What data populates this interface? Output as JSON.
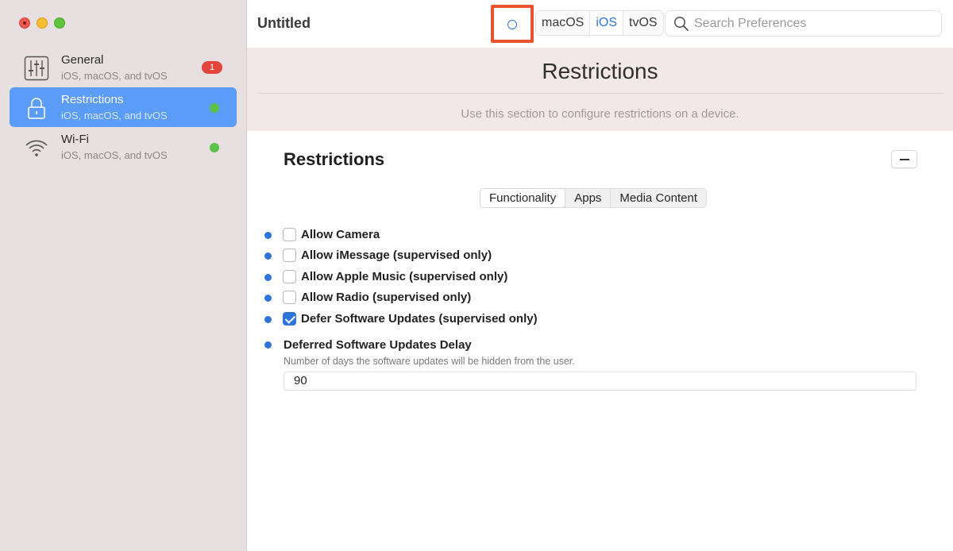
{
  "window": {
    "title": "Untitled"
  },
  "sidebar": {
    "items": [
      {
        "title": "General",
        "subtitle": "iOS, macOS, and tvOS",
        "badge": "1",
        "icon": "sliders-icon"
      },
      {
        "title": "Restrictions",
        "subtitle": "iOS, macOS, and tvOS",
        "icon": "lock-icon",
        "selected": true
      },
      {
        "title": "Wi-Fi",
        "subtitle": "iOS, macOS, and tvOS",
        "icon": "wifi-icon"
      }
    ]
  },
  "toolbar": {
    "platforms": [
      "macOS",
      "iOS",
      "tvOS"
    ],
    "active_platform": "iOS",
    "search_placeholder": "Search Preferences"
  },
  "header": {
    "title": "Restrictions",
    "description": "Use this section to configure restrictions on a device."
  },
  "section": {
    "title": "Restrictions",
    "tabs": [
      "Functionality",
      "Apps",
      "Media Content"
    ],
    "active_tab": "Functionality",
    "options": [
      {
        "label": "Allow Camera",
        "checked": false
      },
      {
        "label": "Allow iMessage (supervised only)",
        "checked": false
      },
      {
        "label": "Allow Apple Music (supervised only)",
        "checked": false
      },
      {
        "label": "Allow Radio (supervised only)",
        "checked": false
      },
      {
        "label": "Defer Software Updates (supervised only)",
        "checked": true
      }
    ],
    "delay_field": {
      "label": "Deferred Software Updates Delay",
      "help": "Number of days the software updates will be hidden from the user.",
      "value": "90"
    }
  },
  "colors": {
    "accent": "#2d74db",
    "highlight": "#e9542f",
    "badge": "#e3453c",
    "status_ok": "#5ac249"
  }
}
